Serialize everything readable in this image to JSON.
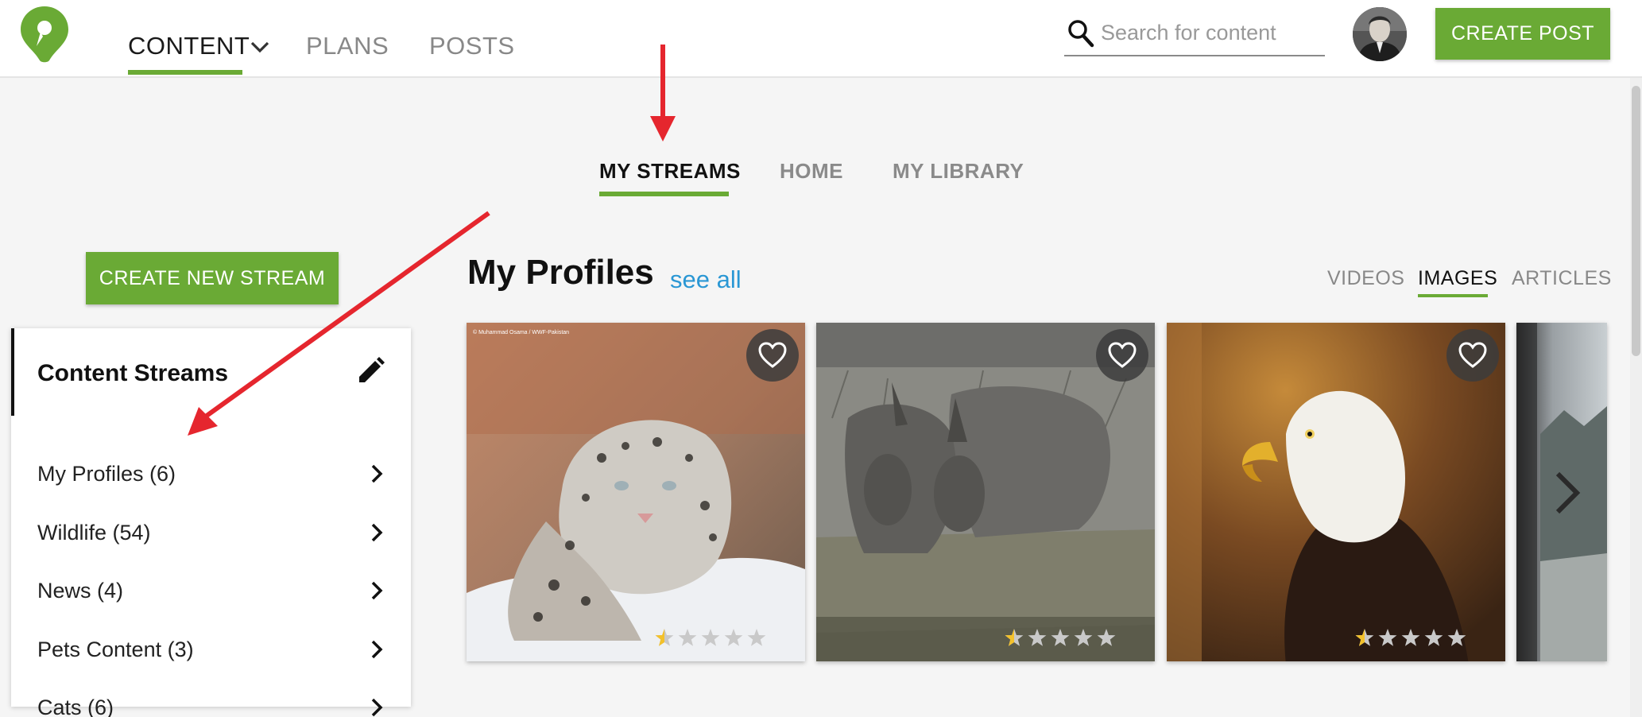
{
  "nav": {
    "items": [
      {
        "label": "CONTENT",
        "active": true,
        "has_dropdown": true
      },
      {
        "label": "PLANS"
      },
      {
        "label": "POSTS"
      }
    ]
  },
  "search": {
    "placeholder": "Search for content",
    "value": ""
  },
  "header": {
    "create_post_label": "CREATE POST"
  },
  "subtabs": [
    {
      "label": "MY STREAMS",
      "active": true
    },
    {
      "label": "HOME"
    },
    {
      "label": "MY LIBRARY"
    }
  ],
  "sidebar": {
    "create_stream_label": "CREATE NEW STREAM",
    "panel_title": "Content Streams",
    "streams": [
      {
        "label": "My Profiles (6)"
      },
      {
        "label": "Wildlife (54)"
      },
      {
        "label": "News (4)"
      },
      {
        "label": "Pets Content (3)"
      },
      {
        "label": "Cats (6)"
      }
    ]
  },
  "main": {
    "section_title": "My Profiles",
    "see_all_label": "see all",
    "filters": [
      {
        "label": "VIDEOS"
      },
      {
        "label": "IMAGES",
        "active": true
      },
      {
        "label": "ARTICLES"
      }
    ],
    "cards": [
      {
        "subject": "snow leopard",
        "caption": "© Muhammad Osama / WWF-Pakistan",
        "rating": 0.5,
        "max_rating": 5
      },
      {
        "subject": "rhinoceros pair",
        "rating": 0.5,
        "max_rating": 5
      },
      {
        "subject": "bald eagle",
        "rating": 0.5,
        "max_rating": 5
      },
      {
        "subject": "mountain landscape"
      }
    ]
  },
  "colors": {
    "accent_green": "#6aaa35",
    "link_blue": "#2a97d4",
    "annotation_red": "#e5262e"
  },
  "icons": [
    "logo-icon",
    "chevron-down-icon",
    "search-icon",
    "pencil-icon",
    "chevron-right-icon",
    "heart-icon",
    "star-icon",
    "next-arrow-icon"
  ]
}
